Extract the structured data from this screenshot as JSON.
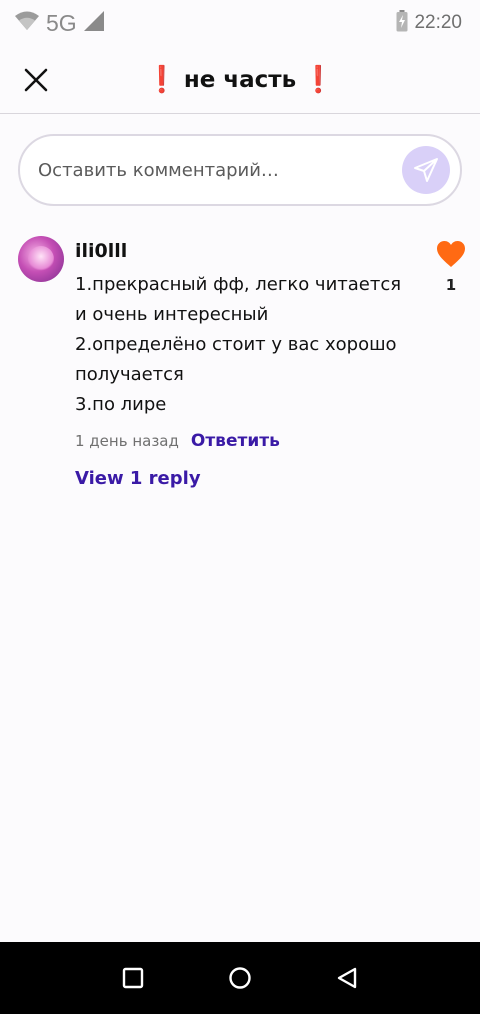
{
  "status_bar": {
    "network": "5G",
    "time": "22:20",
    "icons": [
      "wifi-icon",
      "signal-icon",
      "battery-charging-icon"
    ]
  },
  "header": {
    "title": "не часть",
    "close_icon": "close-icon",
    "title_emoji": "❗"
  },
  "comment_input": {
    "placeholder": "Оставить комментарий…",
    "send_icon": "send-icon"
  },
  "comments": [
    {
      "username": "ili0lll",
      "text": "1.прекрасный фф, легко читается и очень интересный\n2.определёно стоит у вас хорошо получается\n3.по лире",
      "timestamp": "1 день назад",
      "reply_label": "Ответить",
      "view_replies_label": "View 1 reply",
      "likes": "1",
      "liked": true
    }
  ],
  "nav_bar": {
    "items": [
      "recents-square-icon",
      "home-circle-icon",
      "back-triangle-icon"
    ]
  },
  "colors": {
    "accent": "#3a1aa6",
    "like": "#ff6a13",
    "send_bg": "#d9d0f8",
    "alert": "#e23b3b"
  }
}
